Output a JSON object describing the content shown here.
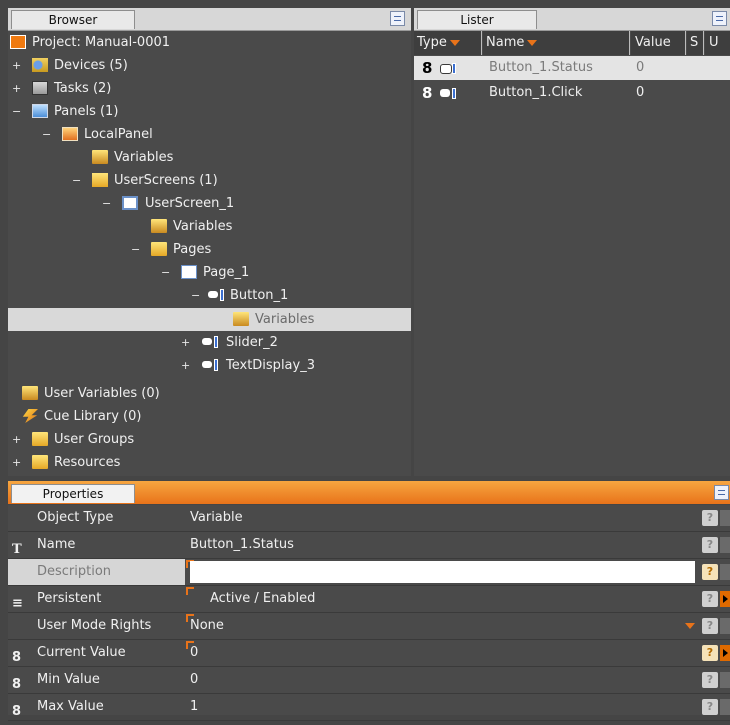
{
  "browser": {
    "tab_label": "Browser",
    "tree": [
      {
        "label": "Project: Manual-0001",
        "icon": "project-icon"
      },
      {
        "label": "Devices (5)",
        "icon": "devices-icon",
        "toggle": "+"
      },
      {
        "label": "Tasks (2)",
        "icon": "tasks-icon",
        "toggle": "+"
      },
      {
        "label": "Panels (1)",
        "icon": "panels-icon",
        "toggle": "−"
      },
      {
        "label": "LocalPanel",
        "icon": "local-panel-icon",
        "toggle": "−"
      },
      {
        "label": "Variables",
        "icon": "variables-folder-icon"
      },
      {
        "label": "UserScreens (1)",
        "icon": "userscreens-icon",
        "toggle": "−"
      },
      {
        "label": "UserScreen_1",
        "icon": "userscreen-icon",
        "toggle": "−"
      },
      {
        "label": "Variables",
        "icon": "variables-folder-icon"
      },
      {
        "label": "Pages",
        "icon": "folder-icon",
        "toggle": "−"
      },
      {
        "label": "Page_1",
        "icon": "page-icon",
        "toggle": "−"
      },
      {
        "label": "Button_1",
        "icon": "button-object-icon",
        "toggle": "−"
      },
      {
        "label": "Variables",
        "icon": "variables-folder-icon"
      },
      {
        "label": "Slider_2",
        "icon": "slider-object-icon",
        "toggle": "+"
      },
      {
        "label": "TextDisplay_3",
        "icon": "textdisplay-object-icon",
        "toggle": "+"
      },
      {
        "label": "User Variables (0)",
        "icon": "variables-folder-icon"
      },
      {
        "label": "Cue Library (0)",
        "icon": "cue-library-icon"
      },
      {
        "label": "User Groups",
        "icon": "folder-icon",
        "toggle": "+"
      },
      {
        "label": "Resources",
        "icon": "folder-icon",
        "toggle": "+"
      }
    ]
  },
  "lister": {
    "tab_label": "Lister",
    "columns": [
      "Type",
      "Name",
      "Value",
      "S",
      "U"
    ],
    "rows": [
      {
        "type_glyph": "8",
        "name": "Button_1.Status",
        "value": "0"
      },
      {
        "type_glyph": "8",
        "name": "Button_1.Click",
        "value": "0"
      }
    ]
  },
  "properties": {
    "tab_label": "Properties",
    "rows": [
      {
        "name": "Object Type",
        "value": "Variable",
        "icon_glyph": ""
      },
      {
        "name": "Name",
        "value": "Button_1.Status",
        "icon_glyph": "T"
      },
      {
        "name": "Description",
        "value": "",
        "icon_glyph": ""
      },
      {
        "name": "Persistent",
        "value": "Active / Enabled",
        "icon_glyph": "≡"
      },
      {
        "name": "User Mode Rights",
        "value": "None",
        "icon_glyph": ""
      },
      {
        "name": "Current Value",
        "value": "0",
        "icon_glyph": "8"
      },
      {
        "name": "Min Value",
        "value": "0",
        "icon_glyph": "8"
      },
      {
        "name": "Max Value",
        "value": "1",
        "icon_glyph": "8"
      }
    ],
    "help_glyph": "?"
  },
  "colors": {
    "accent": "#e8731a",
    "panel_bg": "#4a4a4a",
    "selection": "#d9d9d9"
  }
}
